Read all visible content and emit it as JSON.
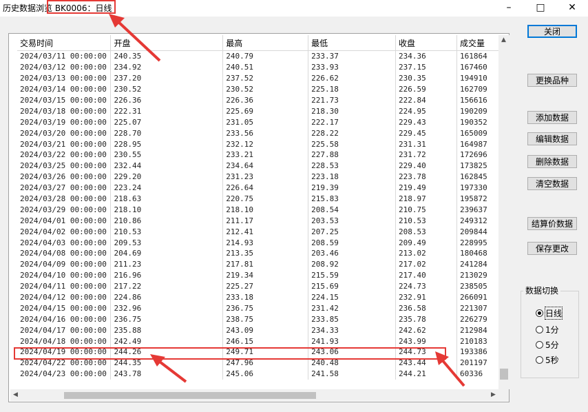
{
  "window": {
    "title": "历史数据浏览 BK0006：日线",
    "minimize_icon": "minimize-icon",
    "maximize_icon": "maximize-icon",
    "close_icon": "close-icon"
  },
  "grid": {
    "columns": [
      "交易时间",
      "开盘",
      "最高",
      "最低",
      "收盘",
      "成交量"
    ],
    "rows": [
      [
        "2024/03/11 00:00:00",
        "240.35",
        "240.79",
        "233.37",
        "234.36",
        "161864"
      ],
      [
        "2024/03/12 00:00:00",
        "234.92",
        "240.51",
        "233.93",
        "237.15",
        "167460"
      ],
      [
        "2024/03/13 00:00:00",
        "237.20",
        "237.52",
        "226.62",
        "230.35",
        "194910"
      ],
      [
        "2024/03/14 00:00:00",
        "230.52",
        "230.52",
        "225.18",
        "226.59",
        "162709"
      ],
      [
        "2024/03/15 00:00:00",
        "226.36",
        "226.36",
        "221.73",
        "222.84",
        "156616"
      ],
      [
        "2024/03/18 00:00:00",
        "222.31",
        "225.69",
        "218.30",
        "224.95",
        "190209"
      ],
      [
        "2024/03/19 00:00:00",
        "225.07",
        "231.05",
        "222.17",
        "229.43",
        "190352"
      ],
      [
        "2024/03/20 00:00:00",
        "228.70",
        "233.56",
        "228.22",
        "229.45",
        "165009"
      ],
      [
        "2024/03/21 00:00:00",
        "228.95",
        "232.12",
        "225.58",
        "231.31",
        "164987"
      ],
      [
        "2024/03/22 00:00:00",
        "230.55",
        "233.21",
        "227.88",
        "231.72",
        "172696"
      ],
      [
        "2024/03/25 00:00:00",
        "232.44",
        "234.64",
        "228.53",
        "229.40",
        "173825"
      ],
      [
        "2024/03/26 00:00:00",
        "229.20",
        "231.23",
        "223.18",
        "223.78",
        "162845"
      ],
      [
        "2024/03/27 00:00:00",
        "223.24",
        "226.64",
        "219.39",
        "219.49",
        "197330"
      ],
      [
        "2024/03/28 00:00:00",
        "218.63",
        "220.75",
        "215.83",
        "218.97",
        "195872"
      ],
      [
        "2024/03/29 00:00:00",
        "218.10",
        "218.10",
        "208.54",
        "210.75",
        "239637"
      ],
      [
        "2024/04/01 00:00:00",
        "210.86",
        "211.17",
        "203.53",
        "210.53",
        "249312"
      ],
      [
        "2024/04/02 00:00:00",
        "210.53",
        "212.41",
        "207.25",
        "208.53",
        "209844"
      ],
      [
        "2024/04/03 00:00:00",
        "209.53",
        "214.93",
        "208.59",
        "209.49",
        "228995"
      ],
      [
        "2024/04/08 00:00:00",
        "204.69",
        "213.35",
        "203.46",
        "213.02",
        "180468"
      ],
      [
        "2024/04/09 00:00:00",
        "211.23",
        "217.81",
        "208.92",
        "217.02",
        "241284"
      ],
      [
        "2024/04/10 00:00:00",
        "216.96",
        "219.34",
        "215.59",
        "217.40",
        "213029"
      ],
      [
        "2024/04/11 00:00:00",
        "217.22",
        "225.27",
        "215.69",
        "224.73",
        "238505"
      ],
      [
        "2024/04/12 00:00:00",
        "224.86",
        "233.18",
        "224.15",
        "232.91",
        "266091"
      ],
      [
        "2024/04/15 00:00:00",
        "232.96",
        "236.75",
        "231.42",
        "236.58",
        "221307"
      ],
      [
        "2024/04/16 00:00:00",
        "236.75",
        "238.75",
        "233.85",
        "235.78",
        "226279"
      ],
      [
        "2024/04/17 00:00:00",
        "235.88",
        "243.09",
        "234.33",
        "242.62",
        "212984"
      ],
      [
        "2024/04/18 00:00:00",
        "242.49",
        "246.15",
        "241.93",
        "243.99",
        "210183"
      ],
      [
        "2024/04/19 00:00:00",
        "244.26",
        "249.71",
        "243.06",
        "244.73",
        "193386"
      ],
      [
        "2024/04/22 00:00:00",
        "244.35",
        "247.96",
        "240.48",
        "243.44",
        "201197"
      ],
      [
        "2024/04/23 00:00:00",
        "243.78",
        "245.06",
        "241.58",
        "244.21",
        "60336"
      ]
    ],
    "highlighted_row": "2024/04/19 00:00:00"
  },
  "buttons": {
    "close": "关闭",
    "change_symbol": "更换品种",
    "add_data": "添加数据",
    "edit_data": "编辑数据",
    "delete_data": "删除数据",
    "clear_data": "清空数据",
    "settlement_data": "结算价数据",
    "save_changes": "保存更改"
  },
  "data_switch": {
    "title": "数据切换",
    "options": [
      "日线",
      "1分",
      "5分",
      "5秒"
    ],
    "selected": "日线"
  },
  "colors": {
    "annotation": "#e53935",
    "primary_border": "#0078d7"
  }
}
